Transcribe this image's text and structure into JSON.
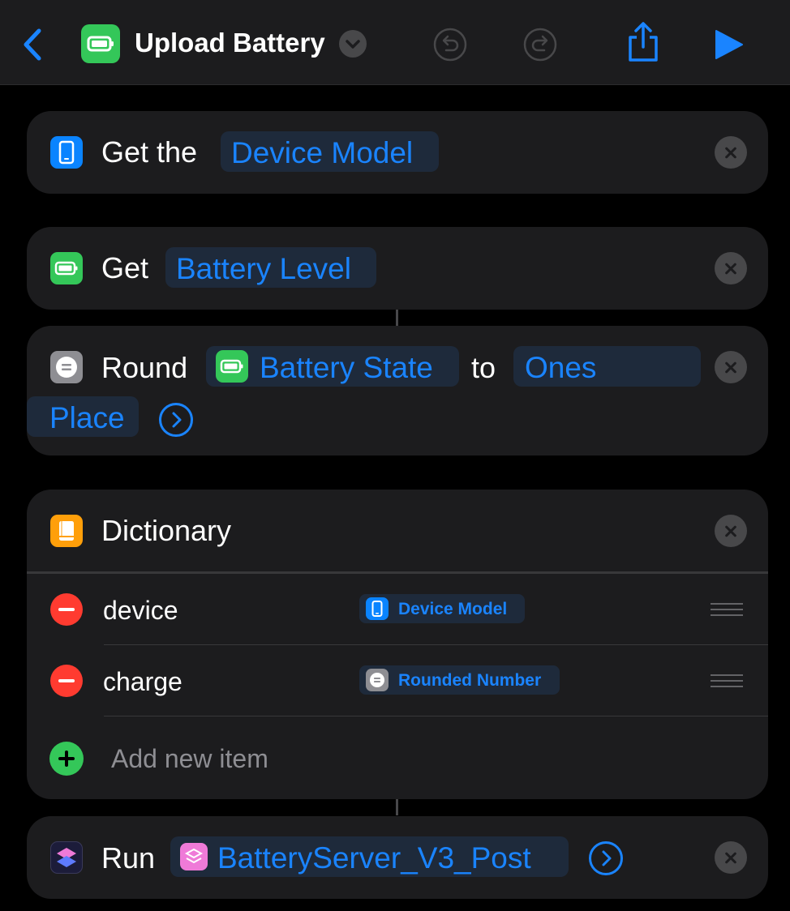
{
  "header": {
    "title": "Upload Battery",
    "icons": [
      "back-chevron-icon",
      "battery-icon",
      "chevron-down-icon",
      "undo-icon",
      "redo-icon",
      "share-icon",
      "play-icon"
    ]
  },
  "actions": {
    "get_device": {
      "label": "Get the",
      "token": "Device Model",
      "icon": "device-icon"
    },
    "get_battery": {
      "label": "Get",
      "token": "Battery Level",
      "icon": "battery-icon"
    },
    "round": {
      "label": "Round",
      "token_input": "Battery State",
      "to": "to",
      "token_place_line1": "Ones",
      "token_place_line2": "Place",
      "icon": "calculator-icon"
    },
    "dictionary": {
      "title": "Dictionary",
      "icon": "book-icon",
      "items": [
        {
          "key": "device",
          "value": "Device Model",
          "value_icon": "device-icon"
        },
        {
          "key": "charge",
          "value": "Rounded Number",
          "value_icon": "calculator-icon"
        }
      ],
      "add_label": "Add new item"
    },
    "run": {
      "label": "Run",
      "token": "BatteryServer_V3_Post",
      "icon": "shortcuts-icon"
    }
  },
  "colors": {
    "accent": "#1a84ff",
    "battery_green": "#34c759",
    "device_blue": "#0a84ff",
    "calc_gray": "#8e8e93",
    "dict_orange": "#ff9f0a",
    "delete_red": "#ff3b30",
    "shortcut_pink": "#ef7ad8"
  }
}
